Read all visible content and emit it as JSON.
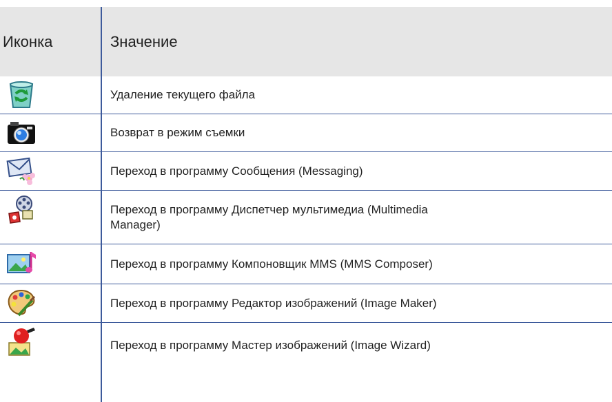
{
  "table": {
    "headers": {
      "icon": "Иконка",
      "meaning": "Значение"
    },
    "rows": [
      {
        "icon": "recycle-bin-icon",
        "text": "Удаление текущего файла"
      },
      {
        "icon": "camera-icon",
        "text": "Возврат в режим съемки"
      },
      {
        "icon": "envelope-flower-icon",
        "text": "Переход в программу Сообщения (Messaging)"
      },
      {
        "icon": "multimedia-manager-icon",
        "text": "Переход в программу Диспетчер мультимедиа (Multimedia Manager)"
      },
      {
        "icon": "mms-composer-icon",
        "text": "Переход в программу Компоновщик MMS (MMS Composer)"
      },
      {
        "icon": "palette-icon",
        "text": "Переход в программу Редактор изображений (Image Maker)"
      },
      {
        "icon": "image-wizard-icon",
        "text": "Переход в программу Мастер изображений (Image Wizard)"
      }
    ]
  },
  "colors": {
    "rule": "#3d5a9b",
    "header_bg": "#e6e6e6"
  }
}
